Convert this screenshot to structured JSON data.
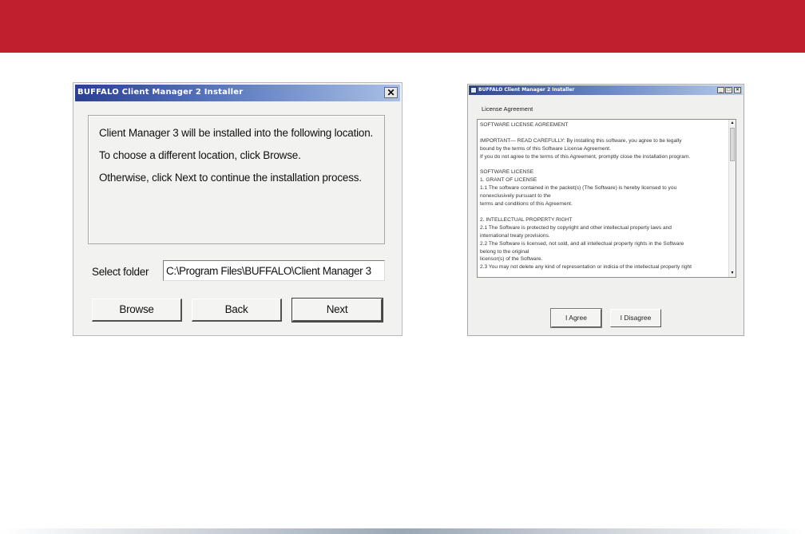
{
  "colors": {
    "banner": "#c0202d",
    "titlebar_start": "#2b3f91",
    "dialog_bg": "#f2f2f0"
  },
  "left_dialog": {
    "title": "BUFFALO Client Manager 2 Installer",
    "close_glyph": "✕",
    "message_lines": [
      "Client Manager 3 will be installed into the following location.",
      "To choose a different location, click Browse.",
      "Otherwise, click Next to continue the installation process."
    ],
    "folder_label": "Select folder",
    "folder_value": "C:\\Program Files\\BUFFALO\\Client Manager 3",
    "buttons": {
      "browse": "Browse",
      "back": "Back",
      "next": "Next"
    }
  },
  "right_dialog": {
    "title": "BUFFALO Client Manager 2 Installer",
    "window_buttons": {
      "minimize": "_",
      "maximize": "□",
      "close": "✕"
    },
    "section_label": "License Agreement",
    "license_lines": [
      "SOFTWARE LICENSE AGREEMENT",
      "",
      "IMPORTANT— READ CAREFULLY: By installing this software, you agree to be legally",
      "bound by the terms of this Software License Agreement.",
      "If you do not agree to the terms of this Agreement, promptly close the installation program.",
      "",
      "SOFTWARE LICENSE",
      "1. GRANT OF LICENSE",
      "1.1 The software contained in the packet(s) (The Software) is hereby licensed to you",
      "nonexclusively pursuant to the",
      "terms and conditions of this Agreement.",
      "",
      "2. INTELLECTUAL PROPERTY RIGHT",
      "2.1 The Software is protected by copyright and other intellectual property laws and",
      "international treaty provisions.",
      "2.2 The Software is licensed, not sold, and all intellectual property rights in the Software",
      "belong to the original",
      "licensor(s) of the Software.",
      "2.3 You may not delete any kind of representation or indicia of the intellectual property right"
    ],
    "buttons": {
      "agree": "I Agree",
      "disagree": "I Disagree"
    }
  }
}
